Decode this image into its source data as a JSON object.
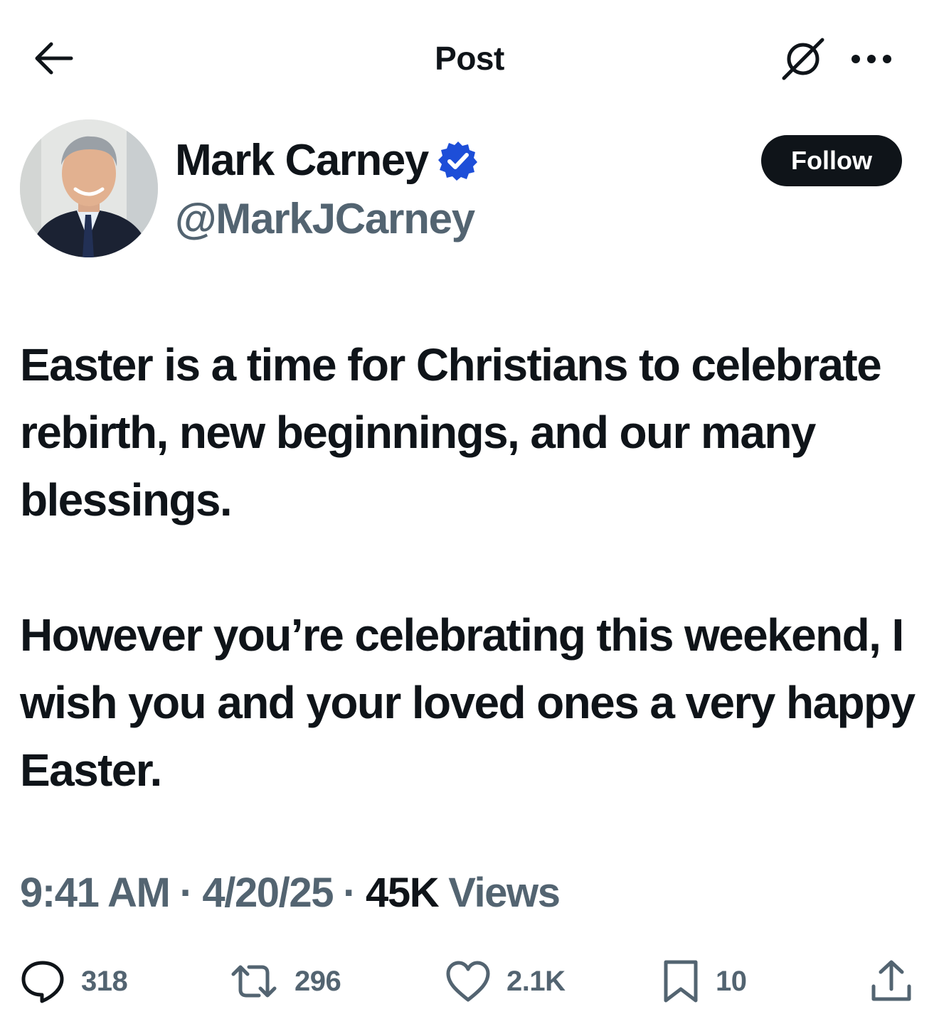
{
  "header": {
    "title": "Post",
    "back_icon": "arrow-left-icon",
    "grok_icon": "grok-icon",
    "more_icon": "more-horizontal-icon"
  },
  "author": {
    "display_name": "Mark Carney",
    "handle": "@MarkJCarney",
    "verified": true,
    "verified_color": "#1d4ed8",
    "follow_label": "Follow"
  },
  "post": {
    "paragraphs": [
      "Easter is a time for Christians to celebrate rebirth, new beginnings, and our many blessings.",
      "However you’re celebrating this weekend, I wish you and your loved ones a very happy Easter."
    ],
    "time": "9:41 AM",
    "date": "4/20/25",
    "views_count": "45K",
    "views_label": "Views",
    "separator": "·"
  },
  "actions": {
    "reply": {
      "icon": "reply-icon",
      "count": "318"
    },
    "repost": {
      "icon": "repost-icon",
      "count": "296"
    },
    "like": {
      "icon": "heart-icon",
      "count": "2.1K"
    },
    "bookmark": {
      "icon": "bookmark-icon",
      "count": "10"
    },
    "share": {
      "icon": "share-icon"
    }
  },
  "colors": {
    "text_primary": "#0f1419",
    "text_secondary": "#536471",
    "follow_bg": "#0f1419",
    "background": "#ffffff"
  }
}
